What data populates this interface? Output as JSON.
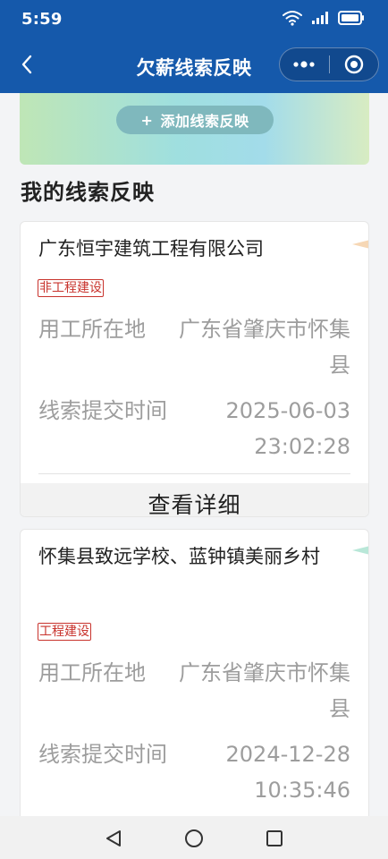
{
  "status_bar": {
    "time": "5:59",
    "icons": [
      "wifi-icon",
      "signal-icon",
      "battery-icon"
    ]
  },
  "nav": {
    "title": "欠薪线索反映",
    "back_icon": "chevron-left-icon",
    "more_icon": "more-dots-icon",
    "close_icon": "target-close-icon"
  },
  "banner": {
    "add_button": {
      "plus": "+",
      "label": "添加线索反映"
    }
  },
  "section": {
    "title": "我的线索反映"
  },
  "cards": [
    {
      "company": "广东恒宇建筑工程有限公司",
      "tag": "非工程建设",
      "location_label": "用工所在地",
      "location_value": "广东省肇庆市怀集县",
      "time_label": "线索提交时间",
      "time_date": "2025-06-03",
      "time_clock": "23:02:28",
      "detail_button": "查看详细"
    },
    {
      "company": "怀集县致远学校、蓝钟镇美丽乡村",
      "tag": "工程建设",
      "location_label": "用工所在地",
      "location_value": "广东省肇庆市怀集县",
      "time_label": "线索提交时间",
      "time_date": "2024-12-28",
      "time_clock": "10:35:46"
    }
  ],
  "colors": {
    "header": "#1559ab",
    "tag_red": "#c8332d",
    "muted_text": "#9d9d9d",
    "add_button": "#7fb8bd"
  },
  "system_nav": {
    "icons": [
      "triangle-back-icon",
      "circle-home-icon",
      "square-recent-icon"
    ]
  }
}
